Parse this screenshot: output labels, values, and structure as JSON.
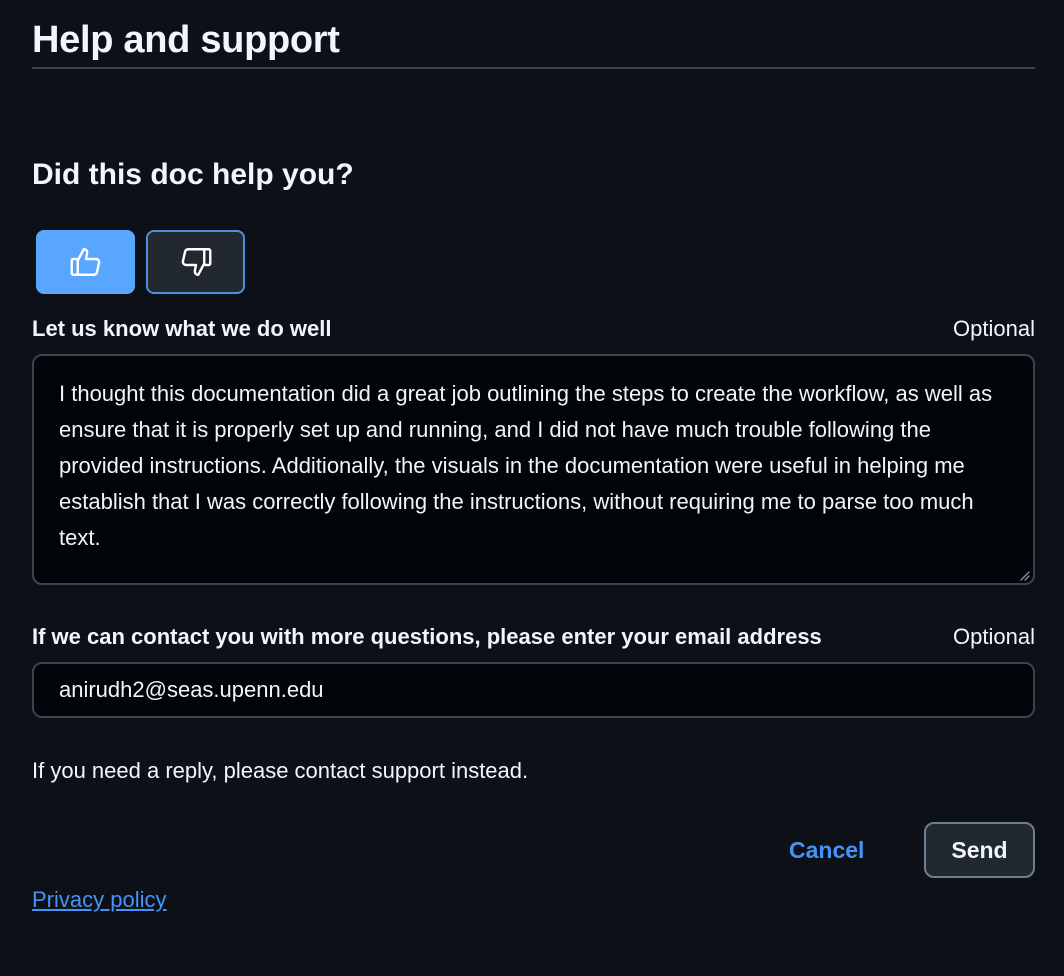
{
  "header": {
    "title": "Help and support"
  },
  "feedback": {
    "question": "Did this doc help you?",
    "thumbs_up": {
      "icon": "thumbs-up-icon",
      "selected": true,
      "color": "#58a6ff"
    },
    "thumbs_down": {
      "icon": "thumbs-down-icon",
      "selected": false
    },
    "praise_field": {
      "label": "Let us know what we do well",
      "optional": "Optional",
      "value": "I thought this documentation did a great job outlining the steps to create the workflow, as well as ensure that it is properly set up and running, and I did not have much trouble following the provided instructions. Additionally, the visuals in the documentation were useful in helping me establish that I was correctly following the instructions, without requiring me to parse too much text."
    },
    "email_field": {
      "label": "If we can contact you with more questions, please enter your email address",
      "optional": "Optional",
      "value": "anirudh2@seas.upenn.edu"
    },
    "reply_note": "If you need a reply, please contact support instead.",
    "cancel_label": "Cancel",
    "send_label": "Send"
  },
  "footer": {
    "privacy_label": "Privacy policy"
  },
  "colors": {
    "background": "#0d1117",
    "accent": "#58a6ff",
    "link": "#4493f8",
    "input_background": "#010409",
    "border": "#3d444d"
  }
}
